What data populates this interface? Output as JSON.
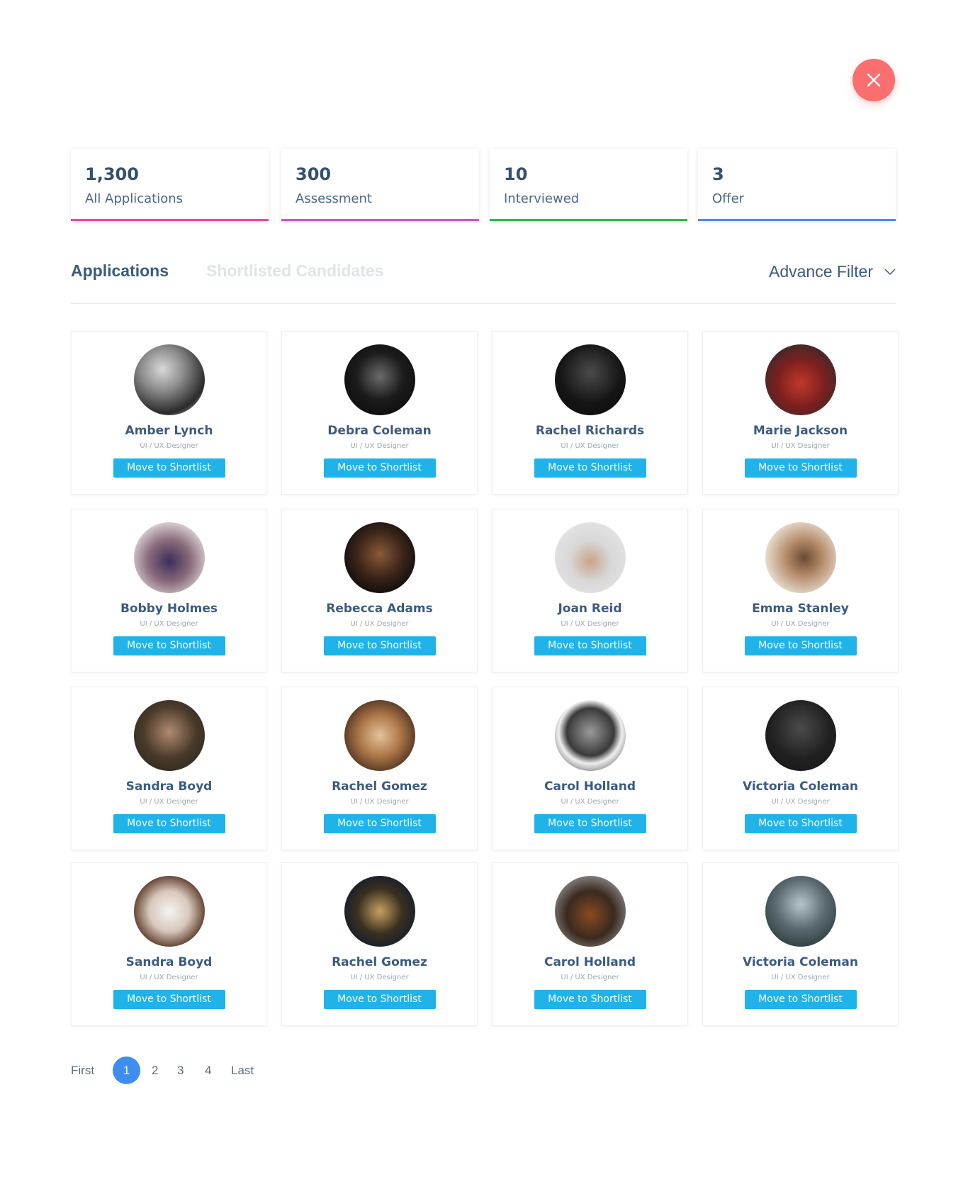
{
  "stats": [
    {
      "value": "1,300",
      "label": "All Applications",
      "color": "#f2479a"
    },
    {
      "value": "300",
      "label": "Assessment",
      "color": "#d64fd9"
    },
    {
      "value": "10",
      "label": "Interviewed",
      "color": "#2bc13a"
    },
    {
      "value": "3",
      "label": "Offer",
      "color": "#4f8ae8"
    }
  ],
  "tabs": {
    "applications": "Applications",
    "shortlisted": "Shortlisted Candidates",
    "filter": "Advance Filter"
  },
  "candidates": [
    {
      "name": "Amber Lynch",
      "role": "UI / UX Designer",
      "action": "Move to Shortlist"
    },
    {
      "name": "Debra Coleman",
      "role": "UI / UX Designer",
      "action": "Move to Shortlist"
    },
    {
      "name": "Rachel Richards",
      "role": "UI / UX Designer",
      "action": "Move to Shortlist"
    },
    {
      "name": "Marie Jackson",
      "role": "UI / UX Designer",
      "action": "Move to Shortlist"
    },
    {
      "name": "Bobby Holmes",
      "role": "UI / UX Designer",
      "action": "Move to Shortlist"
    },
    {
      "name": "Rebecca Adams",
      "role": "UI / UX Designer",
      "action": "Move to Shortlist"
    },
    {
      "name": "Joan Reid",
      "role": "UI / UX Designer",
      "action": "Move to Shortlist"
    },
    {
      "name": "Emma Stanley",
      "role": "UI / UX Designer",
      "action": "Move to Shortlist"
    },
    {
      "name": "Sandra Boyd",
      "role": "UI / UX Designer",
      "action": "Move to Shortlist"
    },
    {
      "name": "Rachel Gomez",
      "role": "UI / UX Designer",
      "action": "Move to Shortlist"
    },
    {
      "name": "Carol Holland",
      "role": "UI / UX Designer",
      "action": "Move to Shortlist"
    },
    {
      "name": "Victoria Coleman",
      "role": "UI / UX Designer",
      "action": "Move to Shortlist"
    },
    {
      "name": "Sandra Boyd",
      "role": "UI / UX Designer",
      "action": "Move to Shortlist"
    },
    {
      "name": "Rachel Gomez",
      "role": "UI / UX Designer",
      "action": "Move to Shortlist"
    },
    {
      "name": "Carol Holland",
      "role": "UI / UX Designer",
      "action": "Move to Shortlist"
    },
    {
      "name": "Victoria Coleman",
      "role": "UI / UX Designer",
      "action": "Move to Shortlist"
    }
  ],
  "pagination": {
    "first": "First",
    "pages": [
      "1",
      "2",
      "3",
      "4"
    ],
    "current": "1",
    "last": "Last"
  }
}
